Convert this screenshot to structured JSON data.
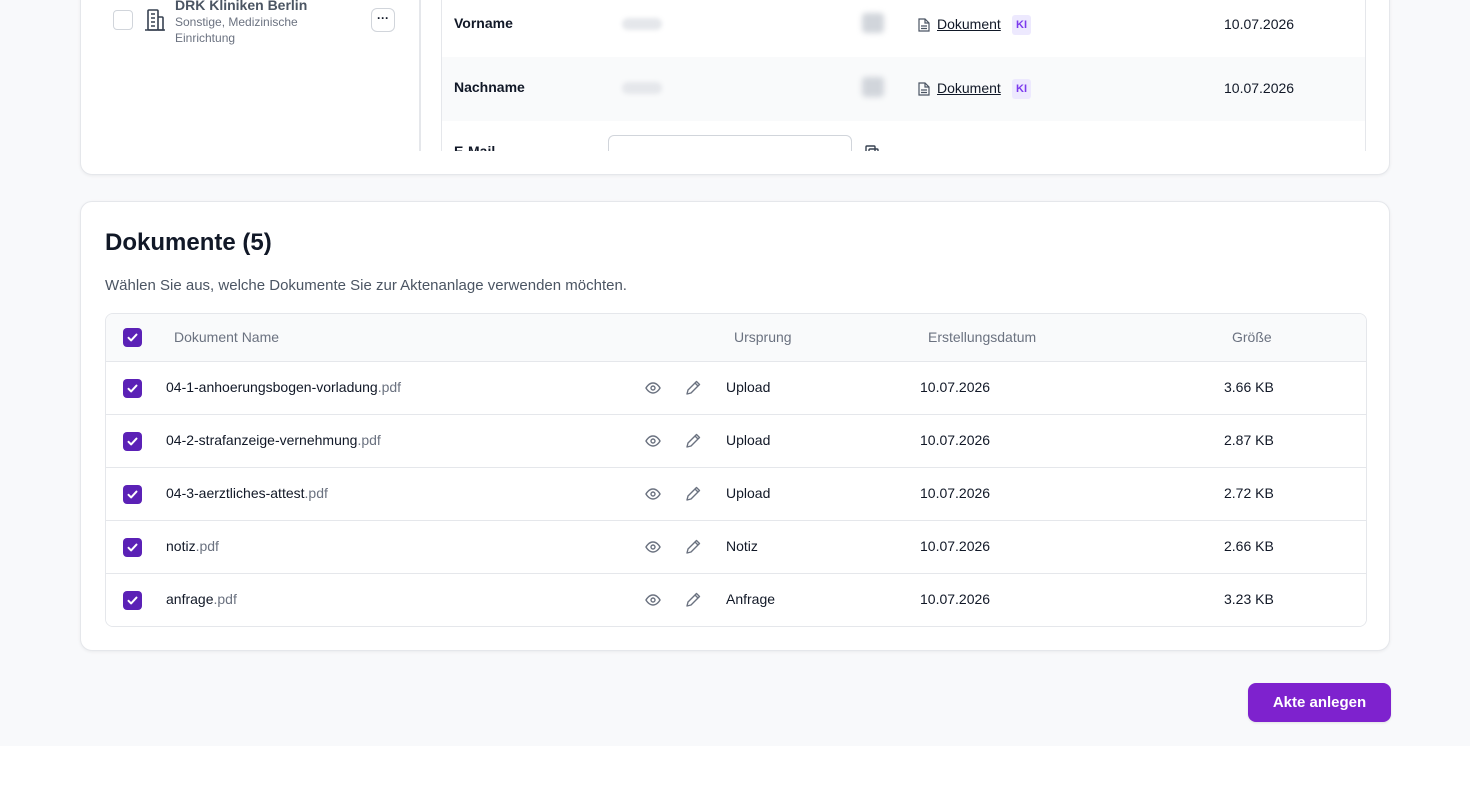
{
  "entity": {
    "name": "DRK Kliniken Berlin",
    "subtitle": "Sonstige, Medizinische Einrichtung",
    "more_label": "···"
  },
  "fields": [
    {
      "label": "Vorname",
      "doc_label": "Dokument",
      "badge": "KI",
      "date": "10.07.2026"
    },
    {
      "label": "Nachname",
      "doc_label": "Dokument",
      "badge": "KI",
      "date": "10.07.2026"
    },
    {
      "label": "E-Mail"
    }
  ],
  "documents": {
    "title": "Dokumente (5)",
    "description": "Wählen Sie aus, welche Dokumente Sie zur Aktenanlage verwenden möchten.",
    "columns": {
      "name": "Dokument Name",
      "origin": "Ursprung",
      "created": "Erstellungsdatum",
      "size": "Größe"
    },
    "rows": [
      {
        "name": "04-1-anhoerungsbogen-vorladung",
        "ext": ".pdf",
        "origin": "Upload",
        "date": "10.07.2026",
        "size": "3.66 KB"
      },
      {
        "name": "04-2-strafanzeige-vernehmung",
        "ext": ".pdf",
        "origin": "Upload",
        "date": "10.07.2026",
        "size": "2.87 KB"
      },
      {
        "name": "04-3-aerztliches-attest",
        "ext": ".pdf",
        "origin": "Upload",
        "date": "10.07.2026",
        "size": "2.72 KB"
      },
      {
        "name": "notiz",
        "ext": ".pdf",
        "origin": "Notiz",
        "date": "10.07.2026",
        "size": "2.66 KB"
      },
      {
        "name": "anfrage",
        "ext": ".pdf",
        "origin": "Anfrage",
        "date": "10.07.2026",
        "size": "3.23 KB"
      }
    ]
  },
  "actions": {
    "create_label": "Akte anlegen"
  },
  "colors": {
    "accent": "#7e22ce",
    "checkbox": "#5b21b6",
    "badge_bg": "#ede9fe",
    "badge_text": "#7c3aed"
  },
  "icons": [
    "building-icon",
    "document-icon",
    "copy-icon",
    "eye-icon",
    "pencil-icon",
    "checkmark-icon"
  ]
}
